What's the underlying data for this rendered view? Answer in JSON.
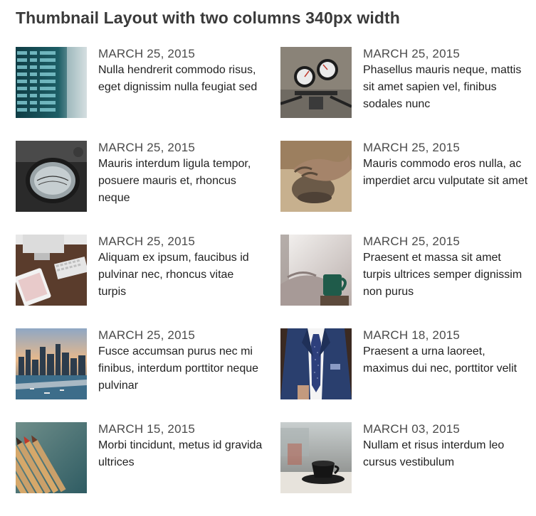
{
  "page": {
    "title": "Thumbnail Layout with two columns 340px width"
  },
  "posts": [
    {
      "date": "MARCH 25, 2015",
      "title": "Nulla hendrerit commodo risus, eget dignissim nulla feugiat sed",
      "thumbnail": "departure-board-image"
    },
    {
      "date": "MARCH 25, 2015",
      "title": "Phasellus mauris neque, mattis sit amet sapien vel, finibus sodales nunc",
      "thumbnail": "motorcycle-gauges-image"
    },
    {
      "date": "MARCH 25, 2015",
      "title": "Mauris interdum ligula tempor, posuere mauris et, rhoncus neque",
      "thumbnail": "vintage-lens-image"
    },
    {
      "date": "MARCH 25, 2015",
      "title": "Mauris commodo eros nulla, ac imperdiet arcu vulputate sit amet",
      "thumbnail": "clay-hands-image"
    },
    {
      "date": "MARCH 25, 2015",
      "title": "Aliquam ex ipsum, faucibus id pulvinar nec, rhoncus vitae turpis",
      "thumbnail": "desk-keyboard-image"
    },
    {
      "date": "MARCH 25, 2015",
      "title": "Praesent et massa sit amet turpis ultrices semper dignissim non purus",
      "thumbnail": "bed-mug-image"
    },
    {
      "date": "MARCH 25, 2015",
      "title": "Fusce accumsan purus nec mi finibus, interdum porttitor neque pulvinar",
      "thumbnail": "city-skyline-image"
    },
    {
      "date": "MARCH 18, 2015",
      "title": "Praesent a urna laoreet, maximus dui nec, porttitor velit",
      "thumbnail": "suit-tie-image"
    },
    {
      "date": "MARCH 15, 2015",
      "title": "Morbi tincidunt, metus id gravida ultrices",
      "thumbnail": "colored-pencils-image"
    },
    {
      "date": "MARCH 03, 2015",
      "title": "Nullam et risus interdum leo cursus vestibulum",
      "thumbnail": "coffee-cup-image"
    }
  ]
}
